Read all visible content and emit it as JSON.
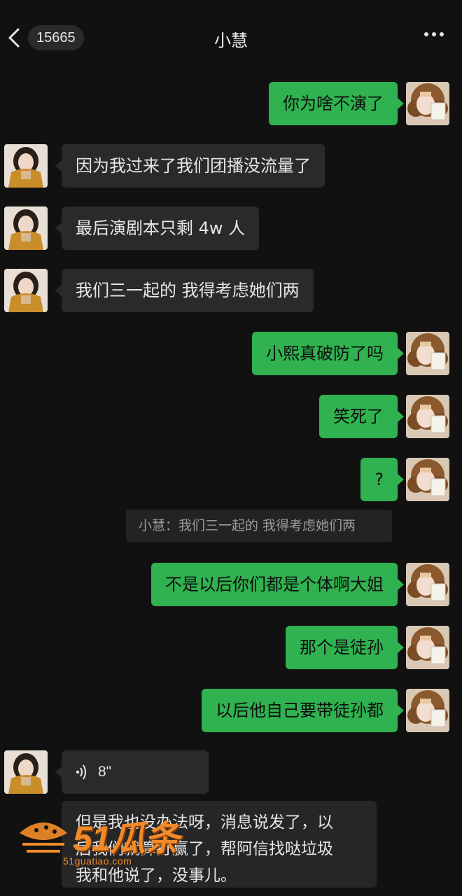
{
  "header": {
    "back_count": "15665",
    "title": "小慧"
  },
  "messages": [
    {
      "sender": "me",
      "text": "你为啥不演了"
    },
    {
      "sender": "peer",
      "text": "因为我过来了我们团播没流量了"
    },
    {
      "sender": "peer",
      "text": "最后演剧本只剩 4w 人"
    },
    {
      "sender": "peer",
      "text": "我们三一起的 我得考虑她们两"
    },
    {
      "sender": "me",
      "text": "小熙真破防了吗"
    },
    {
      "sender": "me",
      "text": "笑死了"
    },
    {
      "sender": "me",
      "text": "?"
    },
    {
      "sender": "me",
      "text": "不是以后你们都是个体啊大姐"
    },
    {
      "sender": "me",
      "text": "那个是徒孙"
    },
    {
      "sender": "me",
      "text": "以后他自己要带徒孙都"
    }
  ],
  "quote": {
    "text": "小慧：我们三一起的 我得考虑她们两"
  },
  "voice_message": {
    "duration": "8\"",
    "transcript_lines": [
      "但是我也没办法呀，消息说发了，以",
      "后我们就算打赢了，帮阿信找哒垃圾",
      "我和他说了，没事儿。"
    ]
  },
  "watermark": {
    "brand": "51瓜条",
    "url": "51guatiao.com",
    "color": "#f08a2a"
  },
  "colors": {
    "background": "#111111",
    "my_bubble": "#2fb24f",
    "peer_bubble": "#2a2a2a"
  }
}
